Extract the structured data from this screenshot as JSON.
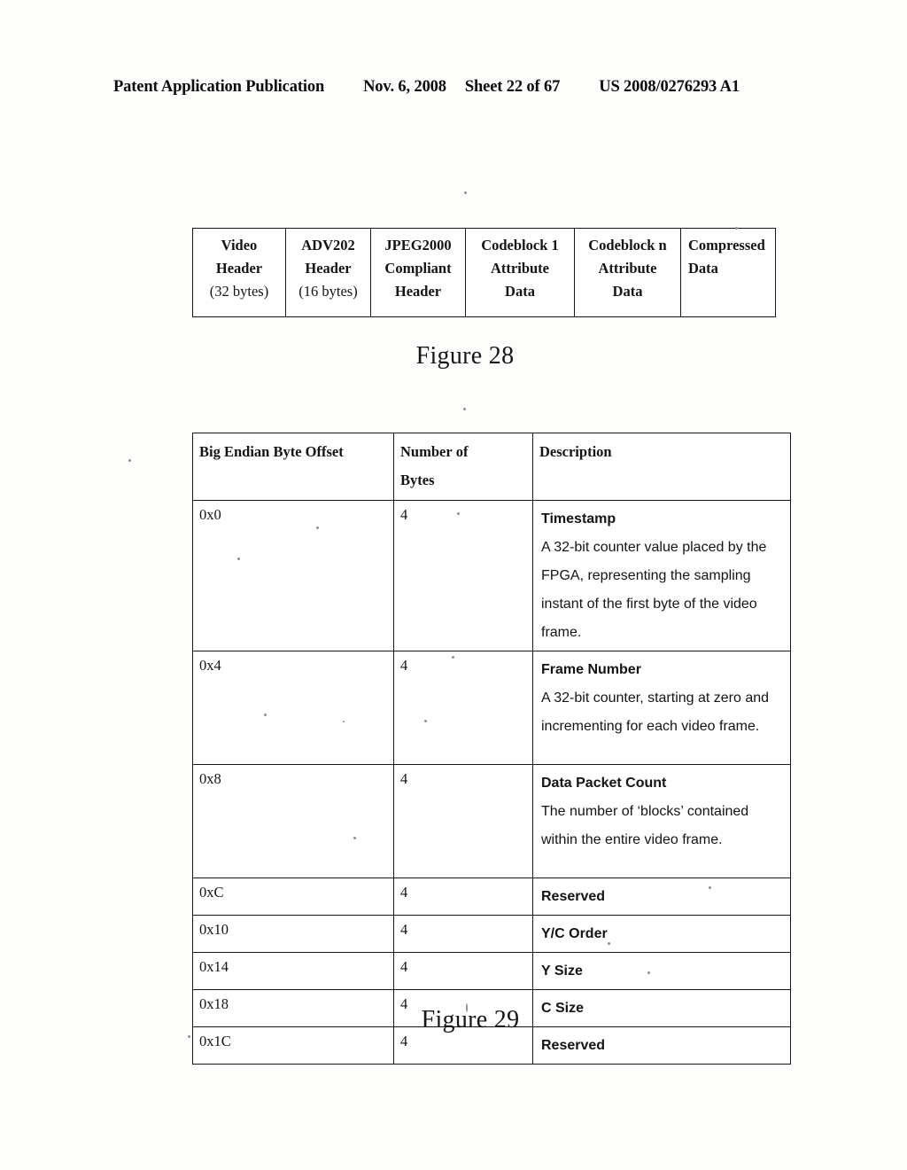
{
  "header": {
    "publication": "Patent Application Publication",
    "date": "Nov. 6, 2008",
    "sheet": "Sheet 22 of 67",
    "patent_number": "US 2008/0276293 A1"
  },
  "figure28": {
    "caption": "Figure 28",
    "cells": [
      {
        "line1": "Video",
        "line2": "Header",
        "note": "(32 bytes)",
        "align": "center"
      },
      {
        "line1": "ADV202",
        "line2": "Header",
        "note": "(16 bytes)",
        "align": "center"
      },
      {
        "line1": "JPEG2000",
        "line2": "Compliant",
        "note": "Header",
        "align": "center"
      },
      {
        "line1": "Codeblock 1",
        "line2": "Attribute",
        "note": "Data",
        "align": "center"
      },
      {
        "line1": "Codeblock n",
        "line2": "Attribute",
        "note": "Data",
        "align": "center"
      },
      {
        "line1": "Compressed",
        "line2": "Data",
        "note": "",
        "align": "left"
      }
    ]
  },
  "figure29": {
    "caption": "Figure 29",
    "columns": [
      "Big Endian Byte Offset",
      "Number of Bytes",
      "Description"
    ],
    "rows": [
      {
        "offset": "0x0",
        "bytes": "4",
        "title": "Timestamp",
        "body": "A 32-bit counter value placed by the FPGA, representing the sampling instant of the first byte of the video frame."
      },
      {
        "offset": "0x4",
        "bytes": "4",
        "title": "Frame Number",
        "body": "A 32-bit counter, starting at zero and incrementing for each video frame."
      },
      {
        "offset": "0x8",
        "bytes": "4",
        "title": "Data Packet Count",
        "body": "The number of ‘blocks’ contained within the entire video frame."
      },
      {
        "offset": "0xC",
        "bytes": "4",
        "title": "Reserved",
        "body": ""
      },
      {
        "offset": "0x10",
        "bytes": "4",
        "title": "Y/C Order",
        "body": ""
      },
      {
        "offset": "0x14",
        "bytes": "4",
        "title": "Y Size",
        "body": ""
      },
      {
        "offset": "0x18",
        "bytes": "4",
        "title": "C Size",
        "body": ""
      },
      {
        "offset": "0x1C",
        "bytes": "4",
        "title": "Reserved",
        "body": ""
      }
    ]
  }
}
